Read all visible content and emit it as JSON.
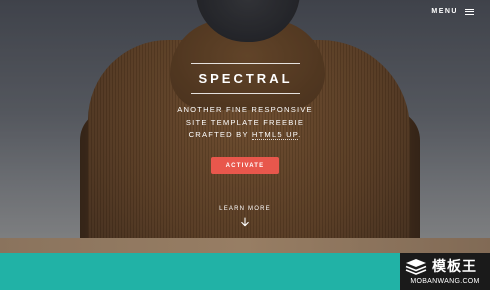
{
  "header": {
    "menu_label": "MENU"
  },
  "banner": {
    "title": "SPECTRAL",
    "tagline_line1": "ANOTHER FINE RESPONSIVE",
    "tagline_line2": "SITE TEMPLATE FREEBIE",
    "tagline_line3_prefix": "CRAFTED BY ",
    "tagline_link": "HTML5 UP",
    "tagline_line3_suffix": ".",
    "cta_label": "ACTIVATE",
    "learn_more_label": "LEARN MORE"
  },
  "watermark": {
    "name": "模板王",
    "url": "MOBANWANG.COM"
  },
  "colors": {
    "accent": "#e8574c",
    "teal": "#21b2a6"
  },
  "icons": {
    "menu": "hamburger-icon",
    "learn_more": "arrow-down-icon"
  }
}
